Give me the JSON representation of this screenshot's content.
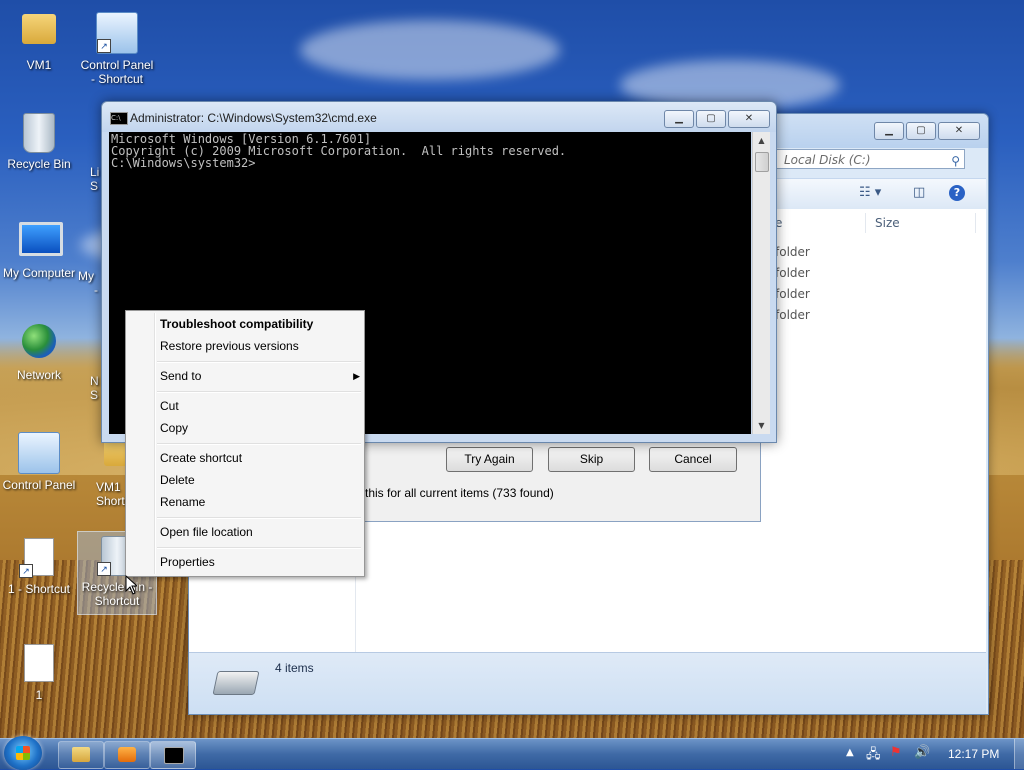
{
  "desktop": {
    "icons": [
      {
        "label": "VM1"
      },
      {
        "label": "Control Panel - Shortcut"
      },
      {
        "label": "Recycle Bin"
      },
      {
        "label": "My Computer"
      },
      {
        "label": "Network"
      },
      {
        "label": "Control Panel"
      },
      {
        "label": "1 - Shortcut"
      },
      {
        "label": "Recycle Bin - Shortcut"
      },
      {
        "label": "1"
      }
    ],
    "partial_labels": [
      "Li",
      "S",
      "My",
      "-",
      "N",
      "S",
      "VM1",
      "Shortc"
    ]
  },
  "cmd": {
    "title": "Administrator: C:\\Windows\\System32\\cmd.exe",
    "icon": "cmd-icon",
    "lines": [
      "Microsoft Windows [Version 6.1.7601]",
      "Copyright (c) 2009 Microsoft Corporation.  All rights reserved.",
      "",
      "C:\\Windows\\system32>"
    ]
  },
  "explorer": {
    "search_placeholder": "Local Disk (C:)",
    "columns": {
      "name_fragment": "e",
      "size": "Size"
    },
    "rows": [
      "folder",
      "folder",
      "folder",
      "folder"
    ],
    "status": "4 items"
  },
  "dialog": {
    "try_again": "Try Again",
    "skip": "Skip",
    "cancel": "Cancel",
    "checkbox_text": "this for all current items (733 found)"
  },
  "context_menu": {
    "items": [
      {
        "label": "Troubleshoot compatibility",
        "bold": true
      },
      {
        "label": "Restore previous versions"
      },
      {
        "label": "Send to",
        "submenu": true
      },
      {
        "label": "Cut"
      },
      {
        "label": "Copy"
      },
      {
        "label": "Create shortcut"
      },
      {
        "label": "Delete"
      },
      {
        "label": "Rename"
      },
      {
        "label": "Open file location"
      },
      {
        "label": "Properties"
      }
    ]
  },
  "taskbar": {
    "clock": "12:17 PM",
    "buttons": [
      "explorer-icon",
      "media-player-icon",
      "cmd-icon"
    ]
  },
  "colors": {
    "taskbar": "#3f6aa6",
    "console_bg": "#000000",
    "console_fg": "#c0c0c0"
  }
}
